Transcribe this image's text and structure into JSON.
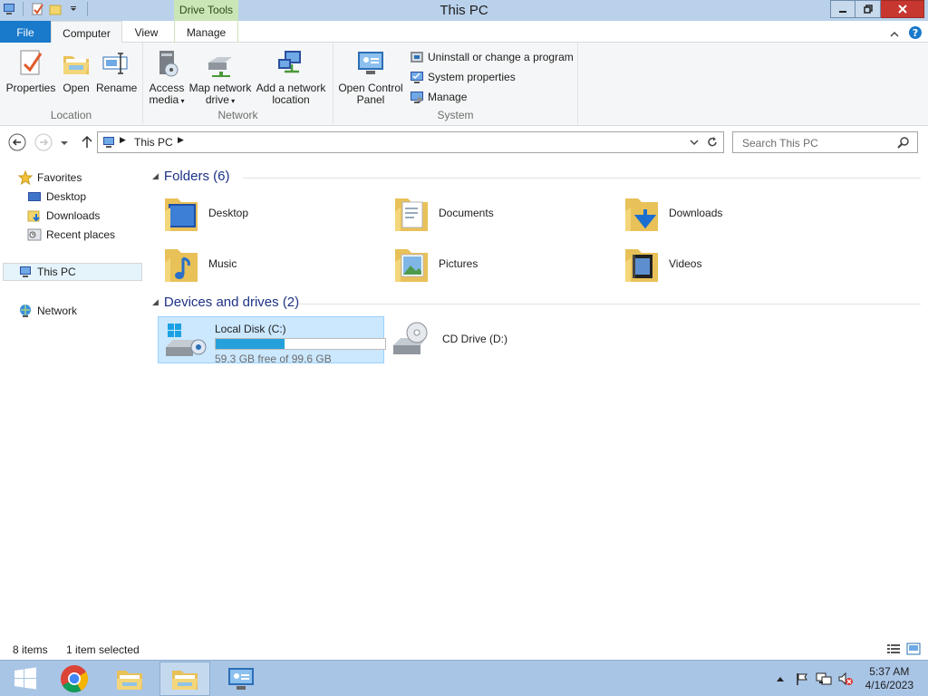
{
  "window": {
    "title": "This PC",
    "contextual_tab_group": "Drive Tools"
  },
  "ribbon": {
    "tabs": [
      {
        "label": "File",
        "active": false
      },
      {
        "label": "Computer",
        "active": true
      },
      {
        "label": "View",
        "active": false
      },
      {
        "label": "Manage",
        "active": false
      }
    ],
    "groups": {
      "location": {
        "label": "Location",
        "buttons": [
          "Properties",
          "Open",
          "Rename"
        ]
      },
      "network": {
        "label": "Network",
        "access_media": [
          "Access",
          "media"
        ],
        "map_drive": [
          "Map network",
          "drive"
        ],
        "add_location": [
          "Add a network",
          "location"
        ]
      },
      "system": {
        "label": "System",
        "control_panel": [
          "Open Control",
          "Panel"
        ],
        "small": [
          "Uninstall or change a program",
          "System properties",
          "Manage"
        ]
      }
    }
  },
  "addressbar": {
    "crumb": "This PC",
    "search_placeholder": "Search This PC"
  },
  "navpane": {
    "favorites": "Favorites",
    "fav_items": [
      "Desktop",
      "Downloads",
      "Recent places"
    ],
    "this_pc": "This PC",
    "network": "Network"
  },
  "content": {
    "folders_header": "Folders (6)",
    "folders": [
      "Desktop",
      "Documents",
      "Downloads",
      "Music",
      "Pictures",
      "Videos"
    ],
    "drives_header": "Devices and drives (2)",
    "drives": [
      {
        "name": "Local Disk (C:)",
        "free_text": "59.3 GB free of 99.6 GB",
        "used_fraction": 0.405
      },
      {
        "name": "CD Drive (D:)"
      }
    ]
  },
  "statusbar": {
    "item_count": "8 items",
    "selection": "1 item selected"
  },
  "taskbar": {
    "time": "5:37 AM",
    "date": "4/16/2023"
  },
  "colors": {
    "accent": "#1979ca",
    "titlebar": "#b9d1ea",
    "drive_tools": "#cbe6b6",
    "selection": "#cce8ff",
    "capacity": "#26a0da"
  }
}
